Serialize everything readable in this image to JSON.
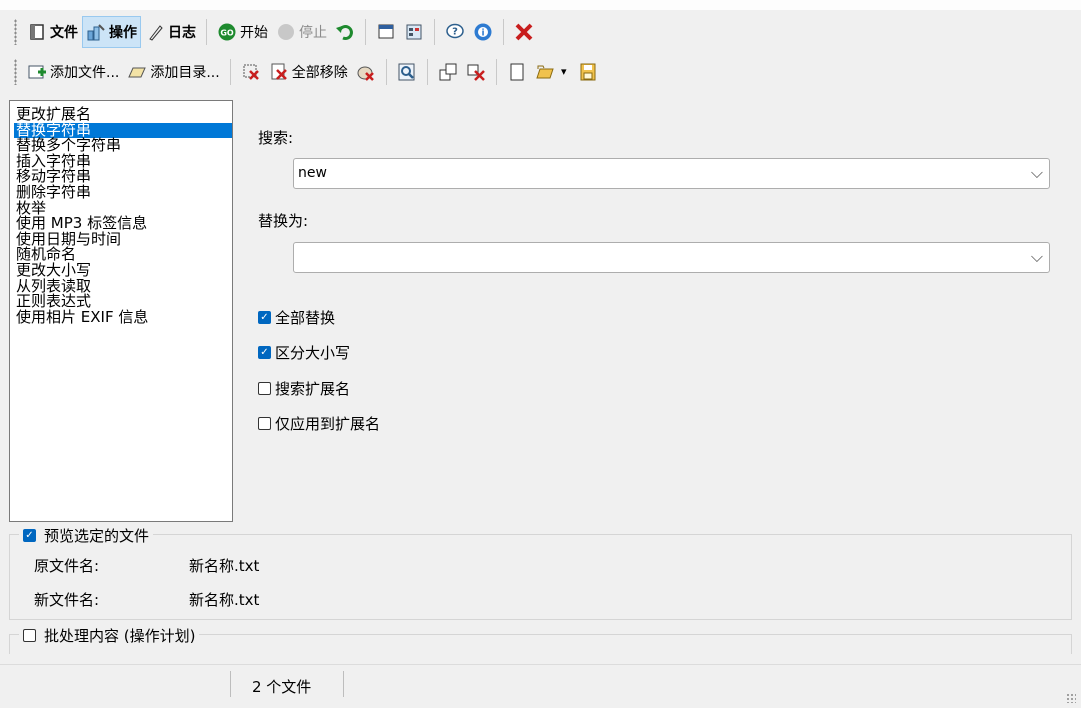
{
  "toolbar1": {
    "file": "文件",
    "operation": "操作",
    "log": "日志",
    "start": "开始",
    "stop": "停止",
    "icons": [
      "panel-icon",
      "operation-icon",
      "log-icon",
      "go-icon",
      "stop-icon",
      "undo-icon",
      "window-icon",
      "calc-icon",
      "help-icon",
      "info-icon",
      "close-icon"
    ]
  },
  "toolbar2": {
    "add_files": "添加文件...",
    "add_folder": "添加目录...",
    "remove_all": "全部移除"
  },
  "methods": {
    "selected_index": 1,
    "items": [
      "更改扩展名",
      "替换字符串",
      "替换多个字符串",
      "插入字符串",
      "移动字符串",
      "删除字符串",
      "枚举",
      "使用 MP3 标签信息",
      "使用日期与时间",
      "随机命名",
      "更改大小写",
      "从列表读取",
      "正则表达式",
      "使用相片 EXIF 信息"
    ]
  },
  "search": {
    "label": "搜索:",
    "value": "new"
  },
  "replace": {
    "label": "替换为:",
    "value": ""
  },
  "options": {
    "replace_all": {
      "label": "全部替换",
      "checked": true
    },
    "case_sensitive": {
      "label": "区分大小写",
      "checked": true
    },
    "search_extension": {
      "label": "搜索扩展名",
      "checked": false
    },
    "extension_only": {
      "label": "仅应用到扩展名",
      "checked": false
    }
  },
  "preview": {
    "label": "预览选定的文件",
    "checked": true,
    "original_label": "原文件名:",
    "original_value": "新名称.txt",
    "new_label": "新文件名:",
    "new_value": "新名称.txt"
  },
  "batch": {
    "label": "批处理内容 (操作计划)",
    "checked": false
  },
  "status": {
    "files": "2 个文件"
  },
  "colors": {
    "selection": "#0078d7",
    "checkbox": "#0067c0",
    "active_tab": "#cce4f7"
  }
}
